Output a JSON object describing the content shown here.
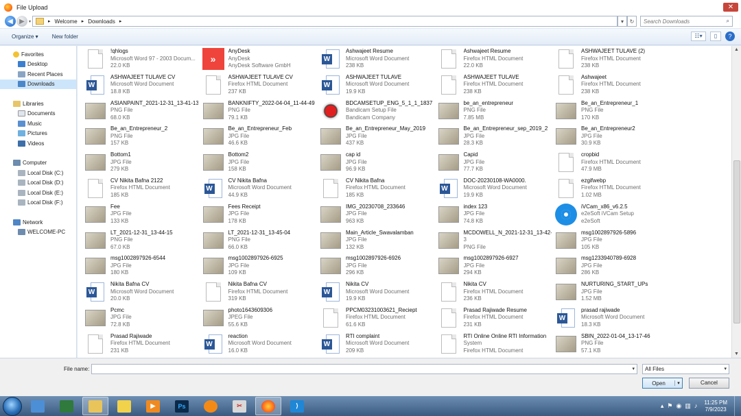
{
  "window": {
    "title": "File Upload",
    "close": "✕"
  },
  "address": {
    "crumbs": [
      "Welcome",
      "Downloads"
    ],
    "search_placeholder": "Search Downloads"
  },
  "toolbar": {
    "organize": "Organize ▾",
    "new_folder": "New folder",
    "help": "?"
  },
  "nav": {
    "favorites": {
      "label": "Favorites",
      "items": [
        "Desktop",
        "Recent Places",
        "Downloads"
      ]
    },
    "libraries": {
      "label": "Libraries",
      "items": [
        "Documents",
        "Music",
        "Pictures",
        "Videos"
      ]
    },
    "computer": {
      "label": "Computer",
      "items": [
        "Local Disk (C:)",
        "Local Disk (D:)",
        "Local Disk (E:)",
        "Local Disk (F:)"
      ]
    },
    "network": {
      "label": "Network",
      "items": [
        "WELCOME-PC"
      ]
    }
  },
  "files": [
    {
      "name": "!qhlogs",
      "type": "Microsoft Word 97 - 2003 Docum...",
      "info": "22.0 KB",
      "icon": "doc"
    },
    {
      "name": "AnyDesk",
      "type": "AnyDesk",
      "info": "AnyDesk Software GmbH",
      "icon": "anydesk"
    },
    {
      "name": "Ashwajeet Resume",
      "type": "Microsoft Word Document",
      "info": "238 KB",
      "icon": "word"
    },
    {
      "name": "Ashwajeet Resume",
      "type": "Firefox HTML Document",
      "info": "22.0 KB",
      "icon": "doc"
    },
    {
      "name": "ASHWAJEET TULAVE (2)",
      "type": "Firefox HTML Document",
      "info": "238 KB",
      "icon": "doc"
    },
    {
      "name": "ASHWAJEET TULAVE CV",
      "type": "Microsoft Word Document",
      "info": "18.8 KB",
      "icon": "word"
    },
    {
      "name": "ASHWAJEET TULAVE CV",
      "type": "Firefox HTML Document",
      "info": "237 KB",
      "icon": "doc"
    },
    {
      "name": "ASHWAJEET TULAVE",
      "type": "Microsoft Word Document",
      "info": "19.9 KB",
      "icon": "word"
    },
    {
      "name": "ASHWAJEET TULAVE",
      "type": "Firefox HTML Document",
      "info": "238 KB",
      "icon": "doc"
    },
    {
      "name": "Ashwajeet",
      "type": "Firefox HTML Document",
      "info": "238 KB",
      "icon": "doc"
    },
    {
      "name": "ASIANPAINT_2021-12-31_13-41-13",
      "type": "PNG File",
      "info": "68.0 KB",
      "icon": "img"
    },
    {
      "name": "BANKNIFTY_2022-04-04_11-44-49",
      "type": "PNG File",
      "info": "79.1 KB",
      "icon": "img"
    },
    {
      "name": "BDCAMSETUP_ENG_5_1_1_1837",
      "type": "Bandicam Setup File",
      "info": "Bandicam Company",
      "icon": "bandicam"
    },
    {
      "name": "be_an_entrepreneur",
      "type": "PNG File",
      "info": "7.85 MB",
      "icon": "img"
    },
    {
      "name": "Be_an_Entrepreneur_1",
      "type": "PNG File",
      "info": "170 KB",
      "icon": "img"
    },
    {
      "name": "Be_an_Entrepreneur_2",
      "type": "PNG File",
      "info": "157 KB",
      "icon": "img"
    },
    {
      "name": "Be_an_Entrepreneur_Feb",
      "type": "JPG File",
      "info": "46.6 KB",
      "icon": "img"
    },
    {
      "name": "Be_an_Entrepreneur_May_2019",
      "type": "JPG File",
      "info": "437 KB",
      "icon": "img"
    },
    {
      "name": "Be_an_Entrepreneur_sep_2019_2",
      "type": "JPG File",
      "info": "28.3 KB",
      "icon": "img"
    },
    {
      "name": "Be_an_Entrepreneur2",
      "type": "JPG File",
      "info": "30.9 KB",
      "icon": "img"
    },
    {
      "name": "Bottom1",
      "type": "JPG File",
      "info": "279 KB",
      "icon": "img"
    },
    {
      "name": "Bottom2",
      "type": "JPG File",
      "info": "158 KB",
      "icon": "img"
    },
    {
      "name": "cap id",
      "type": "JPG File",
      "info": "96.9 KB",
      "icon": "img"
    },
    {
      "name": "Capid",
      "type": "JPG File",
      "info": "77.7 KB",
      "icon": "img"
    },
    {
      "name": "cropbid",
      "type": "Firefox HTML Document",
      "info": "47.9 MB",
      "icon": "doc"
    },
    {
      "name": "CV Nikita Bafna 2122",
      "type": "Firefox HTML Document",
      "info": "185 KB",
      "icon": "doc"
    },
    {
      "name": "CV Nikita Bafna",
      "type": "Microsoft Word Document",
      "info": "44.9 KB",
      "icon": "word"
    },
    {
      "name": "CV Nikita Bafna",
      "type": "Firefox HTML Document",
      "info": "185 KB",
      "icon": "doc"
    },
    {
      "name": "DOC-20230108-WA0000.",
      "type": "Microsoft Word Document",
      "info": "19.9 KB",
      "icon": "word"
    },
    {
      "name": "ezgifwebp",
      "type": "Firefox HTML Document",
      "info": "1.02 MB",
      "icon": "doc"
    },
    {
      "name": "Fee",
      "type": "JPG File",
      "info": "133 KB",
      "icon": "img"
    },
    {
      "name": "Fees Receipt",
      "type": "JPG File",
      "info": "178 KB",
      "icon": "img"
    },
    {
      "name": "IMG_20230708_233646",
      "type": "JPG File",
      "info": "963 KB",
      "icon": "img"
    },
    {
      "name": "index 123",
      "type": "JPG File",
      "info": "74.8 KB",
      "icon": "img"
    },
    {
      "name": "iVCam_x86_v6.2.5",
      "type": "e2eSoft iVCam Setup",
      "info": "e2eSoft",
      "icon": "ivcam"
    },
    {
      "name": "LT_2021-12-31_13-44-15",
      "type": "PNG File",
      "info": "67.0 KB",
      "icon": "img"
    },
    {
      "name": "LT_2021-12-31_13-45-04",
      "type": "PNG File",
      "info": "66.0 KB",
      "icon": "img"
    },
    {
      "name": "Main_Article_Swavalamban",
      "type": "JPG File",
      "info": "132 KB",
      "icon": "img"
    },
    {
      "name": "MCDOWELL_N_2021-12-31_13-42-1",
      "type": "3",
      "info": "PNG File",
      "icon": "img"
    },
    {
      "name": "msg1002897926-5896",
      "type": "JPG File",
      "info": "105 KB",
      "icon": "img"
    },
    {
      "name": "msg1002897926-6544",
      "type": "JPG File",
      "info": "180 KB",
      "icon": "img"
    },
    {
      "name": "msg1002897926-6925",
      "type": "JPG File",
      "info": "109 KB",
      "icon": "img"
    },
    {
      "name": "msg1002897926-6926",
      "type": "JPG File",
      "info": "296 KB",
      "icon": "img"
    },
    {
      "name": "msg1002897926-6927",
      "type": "JPG File",
      "info": "294 KB",
      "icon": "img"
    },
    {
      "name": "msg1233940789-6928",
      "type": "JPG File",
      "info": "286 KB",
      "icon": "img"
    },
    {
      "name": "Nikita Bafna CV",
      "type": "Microsoft Word Document",
      "info": "20.0 KB",
      "icon": "word"
    },
    {
      "name": "Nikita Bafna CV",
      "type": "Firefox HTML Document",
      "info": "319 KB",
      "icon": "doc"
    },
    {
      "name": "Nikita CV",
      "type": "Microsoft Word Document",
      "info": "19.9 KB",
      "icon": "word"
    },
    {
      "name": "Nikita CV",
      "type": "Firefox HTML Document",
      "info": "236 KB",
      "icon": "doc"
    },
    {
      "name": "NURTURING_START_UPs",
      "type": "JPG File",
      "info": "1.52 MB",
      "icon": "img"
    },
    {
      "name": "Pcmc",
      "type": "JPG File",
      "info": "72.8 KB",
      "icon": "img"
    },
    {
      "name": "photo1643609306",
      "type": "JPEG File",
      "info": "55.6 KB",
      "icon": "img"
    },
    {
      "name": "PPCM03231003621_Reciept",
      "type": "Firefox HTML Document",
      "info": "61.6 KB",
      "icon": "doc"
    },
    {
      "name": "Prasad Rajiwade Resume",
      "type": "Firefox HTML Document",
      "info": "231 KB",
      "icon": "doc"
    },
    {
      "name": "prasad rajiwade",
      "type": "Microsoft Word Document",
      "info": "18.3 KB",
      "icon": "word"
    },
    {
      "name": "Prasad Rajiwade",
      "type": "Firefox HTML Document",
      "info": "231 KB",
      "icon": "doc"
    },
    {
      "name": "reaction",
      "type": "Microsoft Word Document",
      "info": "16.0 KB",
      "icon": "word"
    },
    {
      "name": "RTI complaint",
      "type": "Microsoft Word Document",
      "info": "209 KB",
      "icon": "word"
    },
    {
      "name": "RTI Online Online RTI Information",
      "type": "System",
      "info": "Firefox HTML Document",
      "icon": "doc"
    },
    {
      "name": "SBIN_2022-01-04_13-17-46",
      "type": "PNG File",
      "info": "57.1 KB",
      "icon": "img"
    }
  ],
  "bottom": {
    "file_name_label": "File name:",
    "file_name_value": "",
    "file_type": "All Files",
    "open": "Open",
    "cancel": "Cancel"
  },
  "taskbar": {
    "time": "11:25 PM",
    "date": "7/9/2023"
  }
}
